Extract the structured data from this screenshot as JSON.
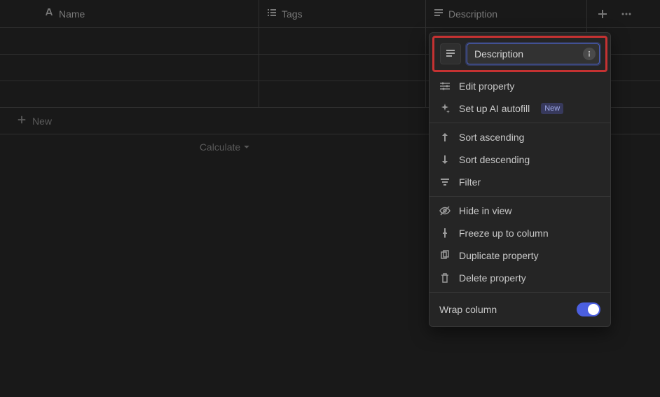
{
  "columns": {
    "name": {
      "label": "Name"
    },
    "tags": {
      "label": "Tags"
    },
    "description": {
      "label": "Description"
    }
  },
  "new_row_label": "New",
  "calculate_label": "Calculate",
  "popup": {
    "property_name": "Description",
    "items": {
      "edit": "Edit property",
      "ai": "Set up AI autofill",
      "ai_badge": "New",
      "sort_asc": "Sort ascending",
      "sort_desc": "Sort descending",
      "filter": "Filter",
      "hide": "Hide in view",
      "freeze": "Freeze up to column",
      "duplicate": "Duplicate property",
      "delete": "Delete property"
    },
    "wrap_label": "Wrap column",
    "wrap_on": true
  }
}
